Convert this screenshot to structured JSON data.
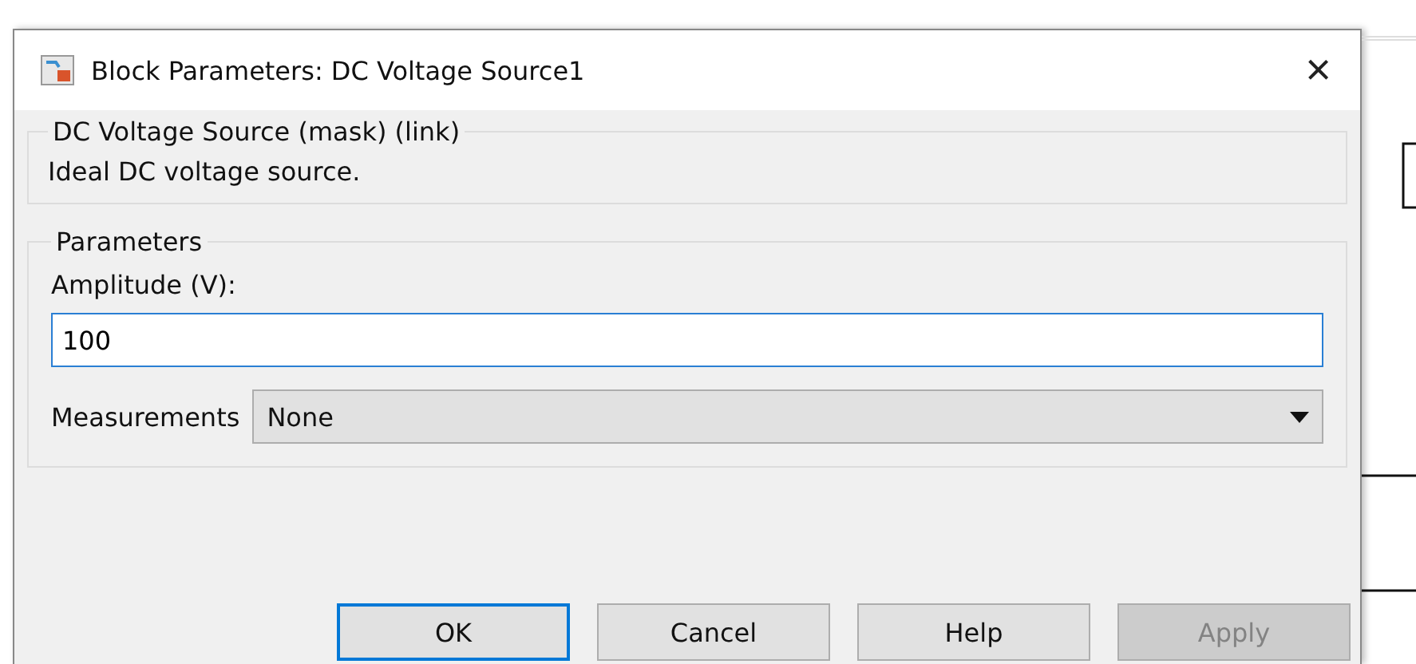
{
  "window": {
    "title": "Block Parameters: DC Voltage Source1",
    "close": "×"
  },
  "description_group": {
    "title": "DC Voltage Source (mask) (link)",
    "text": "Ideal DC voltage source."
  },
  "parameters_group": {
    "title": "Parameters",
    "fields": [
      {
        "kind": "text",
        "label": "Amplitude (V):",
        "value": "100",
        "focused": true
      },
      {
        "kind": "dropdown",
        "label": "Measurements",
        "value": "None"
      }
    ]
  },
  "buttons": [
    {
      "label": "OK",
      "default": true,
      "disabled": false
    },
    {
      "label": "Cancel",
      "default": false,
      "disabled": false
    },
    {
      "label": "Help",
      "default": false,
      "disabled": false
    },
    {
      "label": "Apply",
      "default": false,
      "disabled": true
    }
  ]
}
